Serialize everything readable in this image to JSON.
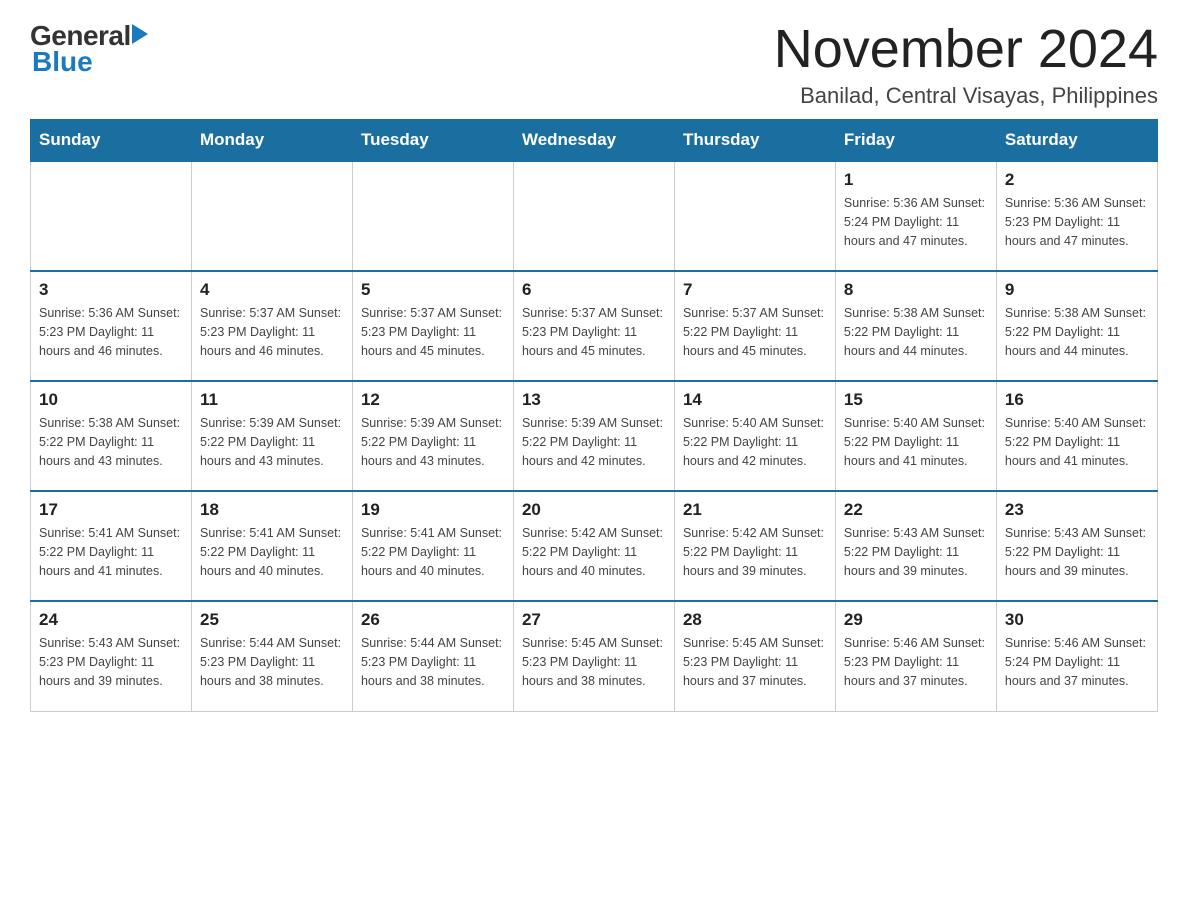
{
  "header": {
    "title": "November 2024",
    "subtitle": "Banilad, Central Visayas, Philippines",
    "logo_general": "General",
    "logo_blue": "Blue"
  },
  "days_of_week": [
    "Sunday",
    "Monday",
    "Tuesday",
    "Wednesday",
    "Thursday",
    "Friday",
    "Saturday"
  ],
  "weeks": [
    {
      "days": [
        {
          "date": "",
          "info": ""
        },
        {
          "date": "",
          "info": ""
        },
        {
          "date": "",
          "info": ""
        },
        {
          "date": "",
          "info": ""
        },
        {
          "date": "",
          "info": ""
        },
        {
          "date": "1",
          "info": "Sunrise: 5:36 AM\nSunset: 5:24 PM\nDaylight: 11 hours and 47 minutes."
        },
        {
          "date": "2",
          "info": "Sunrise: 5:36 AM\nSunset: 5:23 PM\nDaylight: 11 hours and 47 minutes."
        }
      ]
    },
    {
      "days": [
        {
          "date": "3",
          "info": "Sunrise: 5:36 AM\nSunset: 5:23 PM\nDaylight: 11 hours and 46 minutes."
        },
        {
          "date": "4",
          "info": "Sunrise: 5:37 AM\nSunset: 5:23 PM\nDaylight: 11 hours and 46 minutes."
        },
        {
          "date": "5",
          "info": "Sunrise: 5:37 AM\nSunset: 5:23 PM\nDaylight: 11 hours and 45 minutes."
        },
        {
          "date": "6",
          "info": "Sunrise: 5:37 AM\nSunset: 5:23 PM\nDaylight: 11 hours and 45 minutes."
        },
        {
          "date": "7",
          "info": "Sunrise: 5:37 AM\nSunset: 5:22 PM\nDaylight: 11 hours and 45 minutes."
        },
        {
          "date": "8",
          "info": "Sunrise: 5:38 AM\nSunset: 5:22 PM\nDaylight: 11 hours and 44 minutes."
        },
        {
          "date": "9",
          "info": "Sunrise: 5:38 AM\nSunset: 5:22 PM\nDaylight: 11 hours and 44 minutes."
        }
      ]
    },
    {
      "days": [
        {
          "date": "10",
          "info": "Sunrise: 5:38 AM\nSunset: 5:22 PM\nDaylight: 11 hours and 43 minutes."
        },
        {
          "date": "11",
          "info": "Sunrise: 5:39 AM\nSunset: 5:22 PM\nDaylight: 11 hours and 43 minutes."
        },
        {
          "date": "12",
          "info": "Sunrise: 5:39 AM\nSunset: 5:22 PM\nDaylight: 11 hours and 43 minutes."
        },
        {
          "date": "13",
          "info": "Sunrise: 5:39 AM\nSunset: 5:22 PM\nDaylight: 11 hours and 42 minutes."
        },
        {
          "date": "14",
          "info": "Sunrise: 5:40 AM\nSunset: 5:22 PM\nDaylight: 11 hours and 42 minutes."
        },
        {
          "date": "15",
          "info": "Sunrise: 5:40 AM\nSunset: 5:22 PM\nDaylight: 11 hours and 41 minutes."
        },
        {
          "date": "16",
          "info": "Sunrise: 5:40 AM\nSunset: 5:22 PM\nDaylight: 11 hours and 41 minutes."
        }
      ]
    },
    {
      "days": [
        {
          "date": "17",
          "info": "Sunrise: 5:41 AM\nSunset: 5:22 PM\nDaylight: 11 hours and 41 minutes."
        },
        {
          "date": "18",
          "info": "Sunrise: 5:41 AM\nSunset: 5:22 PM\nDaylight: 11 hours and 40 minutes."
        },
        {
          "date": "19",
          "info": "Sunrise: 5:41 AM\nSunset: 5:22 PM\nDaylight: 11 hours and 40 minutes."
        },
        {
          "date": "20",
          "info": "Sunrise: 5:42 AM\nSunset: 5:22 PM\nDaylight: 11 hours and 40 minutes."
        },
        {
          "date": "21",
          "info": "Sunrise: 5:42 AM\nSunset: 5:22 PM\nDaylight: 11 hours and 39 minutes."
        },
        {
          "date": "22",
          "info": "Sunrise: 5:43 AM\nSunset: 5:22 PM\nDaylight: 11 hours and 39 minutes."
        },
        {
          "date": "23",
          "info": "Sunrise: 5:43 AM\nSunset: 5:22 PM\nDaylight: 11 hours and 39 minutes."
        }
      ]
    },
    {
      "days": [
        {
          "date": "24",
          "info": "Sunrise: 5:43 AM\nSunset: 5:23 PM\nDaylight: 11 hours and 39 minutes."
        },
        {
          "date": "25",
          "info": "Sunrise: 5:44 AM\nSunset: 5:23 PM\nDaylight: 11 hours and 38 minutes."
        },
        {
          "date": "26",
          "info": "Sunrise: 5:44 AM\nSunset: 5:23 PM\nDaylight: 11 hours and 38 minutes."
        },
        {
          "date": "27",
          "info": "Sunrise: 5:45 AM\nSunset: 5:23 PM\nDaylight: 11 hours and 38 minutes."
        },
        {
          "date": "28",
          "info": "Sunrise: 5:45 AM\nSunset: 5:23 PM\nDaylight: 11 hours and 37 minutes."
        },
        {
          "date": "29",
          "info": "Sunrise: 5:46 AM\nSunset: 5:23 PM\nDaylight: 11 hours and 37 minutes."
        },
        {
          "date": "30",
          "info": "Sunrise: 5:46 AM\nSunset: 5:24 PM\nDaylight: 11 hours and 37 minutes."
        }
      ]
    }
  ],
  "colors": {
    "header_bg": "#1a6fa0",
    "header_text": "#ffffff",
    "border": "#1a6fa0",
    "logo_blue": "#1a7abf"
  }
}
